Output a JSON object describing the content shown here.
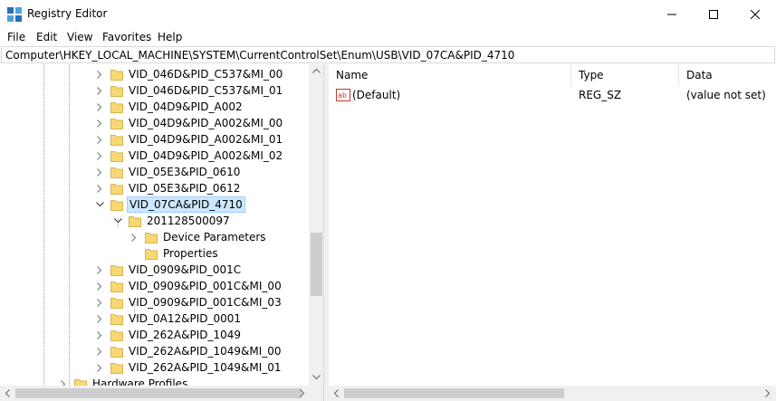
{
  "window": {
    "title": "Registry Editor",
    "min_glyph": "—",
    "max_glyph": "☐",
    "close_glyph": "✕"
  },
  "menu": [
    "File",
    "Edit",
    "View",
    "Favorites",
    "Help"
  ],
  "address": "Computer\\HKEY_LOCAL_MACHINE\\SYSTEM\\CurrentControlSet\\Enum\\USB\\VID_07CA&PID_4710",
  "tree": [
    {
      "label": "VID_046D&PID_C537&MI_00",
      "state": "collapsed"
    },
    {
      "label": "VID_046D&PID_C537&MI_01",
      "state": "collapsed"
    },
    {
      "label": "VID_04D9&PID_A002",
      "state": "collapsed"
    },
    {
      "label": "VID_04D9&PID_A002&MI_00",
      "state": "collapsed"
    },
    {
      "label": "VID_04D9&PID_A002&MI_01",
      "state": "collapsed"
    },
    {
      "label": "VID_04D9&PID_A002&MI_02",
      "state": "collapsed"
    },
    {
      "label": "VID_05E3&PID_0610",
      "state": "collapsed"
    },
    {
      "label": "VID_05E3&PID_0612",
      "state": "collapsed"
    },
    {
      "label": "VID_07CA&PID_4710",
      "state": "expanded",
      "selected": true
    },
    {
      "label": "201128500097",
      "state": "expanded"
    },
    {
      "label": "Device Parameters",
      "state": "collapsed"
    },
    {
      "label": "Properties",
      "state": "leaf"
    },
    {
      "label": "VID_0909&PID_001C",
      "state": "collapsed"
    },
    {
      "label": "VID_0909&PID_001C&MI_00",
      "state": "collapsed"
    },
    {
      "label": "VID_0909&PID_001C&MI_03",
      "state": "collapsed"
    },
    {
      "label": "VID_0A12&PID_0001",
      "state": "collapsed"
    },
    {
      "label": "VID_262A&PID_1049",
      "state": "collapsed"
    },
    {
      "label": "VID_262A&PID_1049&MI_00",
      "state": "collapsed"
    },
    {
      "label": "VID_262A&PID_1049&MI_01",
      "state": "collapsed"
    },
    {
      "label": "Hardware Profiles",
      "state": "collapsed"
    }
  ],
  "columns": [
    "Name",
    "Type",
    "Data"
  ],
  "values": [
    {
      "name": "(Default)",
      "type": "REG_SZ",
      "data": "(value not set)",
      "icon": "string-value-icon"
    }
  ],
  "colors": {
    "selection_bg": "#cce8ff",
    "selection_border": "#99d1ff",
    "folder": "#f8d775"
  }
}
